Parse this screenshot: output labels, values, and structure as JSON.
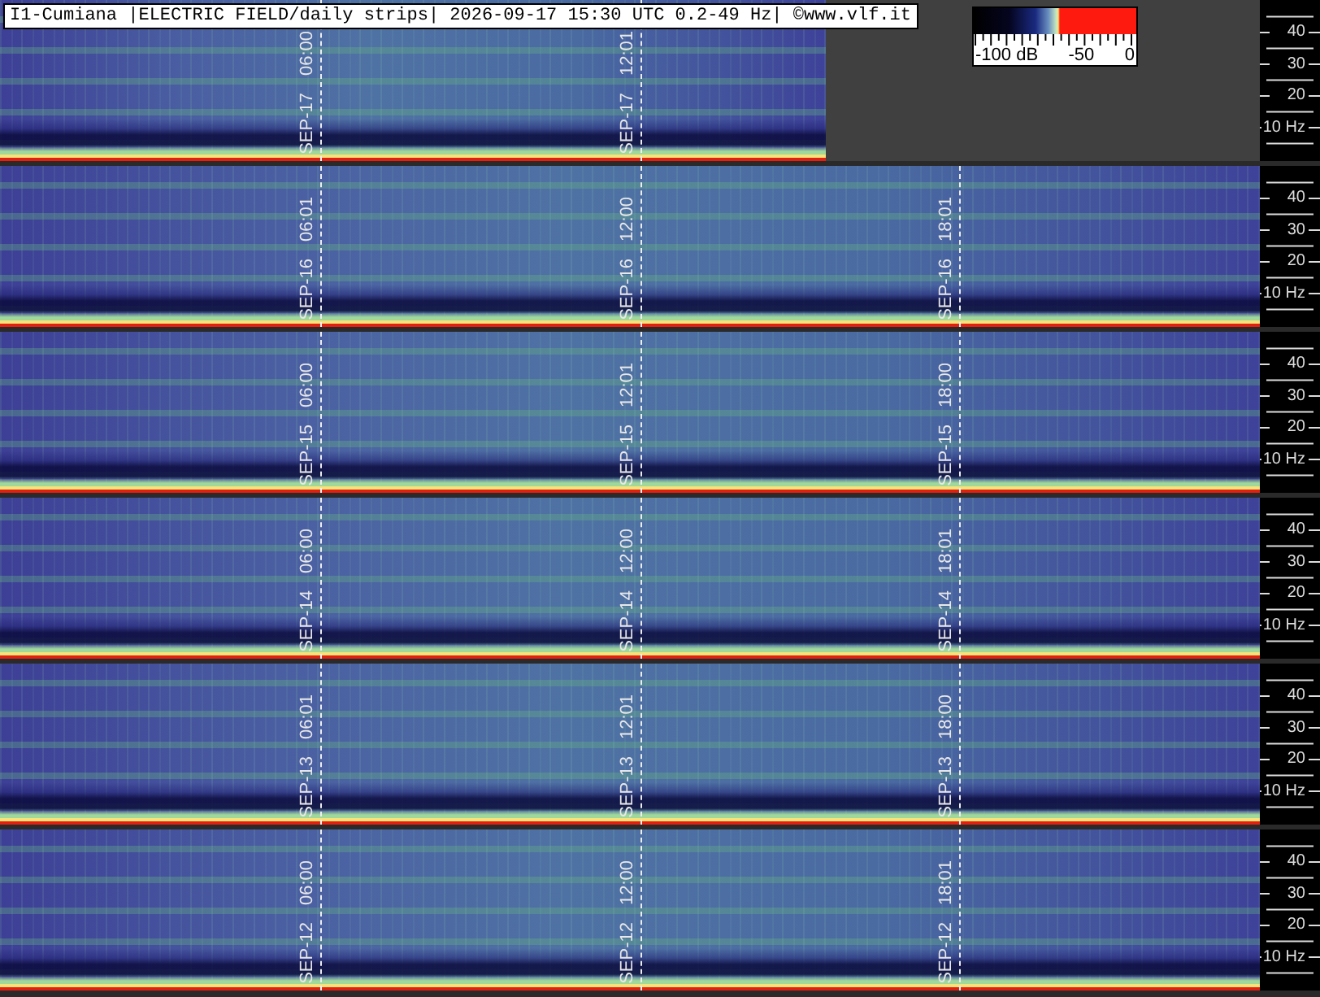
{
  "header": {
    "title": "I1-Cumiana |ELECTRIC FIELD/daily strips| 2026-09-17 15:30 UTC 0.2-49 Hz| ©www.vlf.it"
  },
  "legend": {
    "labels": [
      "-100 dB",
      "-50",
      "0"
    ]
  },
  "strips": [
    {
      "level": 0.655,
      "markers": [
        {
          "date": "SEP-17",
          "time": "06:00"
        },
        {
          "date": "SEP-17",
          "time": "12:01"
        }
      ],
      "axis_labels": [
        "40",
        "30",
        "20",
        "10 Hz"
      ]
    },
    {
      "level": 1,
      "markers": [
        {
          "date": "SEP-16",
          "time": "06:01"
        },
        {
          "date": "SEP-16",
          "time": "12:00"
        },
        {
          "date": "SEP-16",
          "time": "18:01"
        }
      ],
      "axis_labels": [
        "40",
        "30",
        "20",
        "10 Hz"
      ]
    },
    {
      "level": 1,
      "markers": [
        {
          "date": "SEP-15",
          "time": "06:00"
        },
        {
          "date": "SEP-15",
          "time": "12:01"
        },
        {
          "date": "SEP-15",
          "time": "18:00"
        }
      ],
      "axis_labels": [
        "40",
        "30",
        "20",
        "10 Hz"
      ]
    },
    {
      "level": 1,
      "markers": [
        {
          "date": "SEP-14",
          "time": "06:00"
        },
        {
          "date": "SEP-14",
          "time": "12:00"
        },
        {
          "date": "SEP-14",
          "time": "18:01"
        }
      ],
      "axis_labels": [
        "40",
        "30",
        "20",
        "10 Hz"
      ]
    },
    {
      "level": 1,
      "markers": [
        {
          "date": "SEP-13",
          "time": "06:01"
        },
        {
          "date": "SEP-13",
          "time": "12:01"
        },
        {
          "date": "SEP-13",
          "time": "18:00"
        }
      ],
      "axis_labels": [
        "40",
        "30",
        "20",
        "10 Hz"
      ]
    },
    {
      "level": 1,
      "markers": [
        {
          "date": "SEP-12",
          "time": "06:00"
        },
        {
          "date": "SEP-12",
          "time": "12:00"
        },
        {
          "date": "SEP-12",
          "time": "18:01"
        }
      ],
      "axis_labels": [
        "40",
        "30",
        "20",
        "10 Hz"
      ]
    }
  ]
}
